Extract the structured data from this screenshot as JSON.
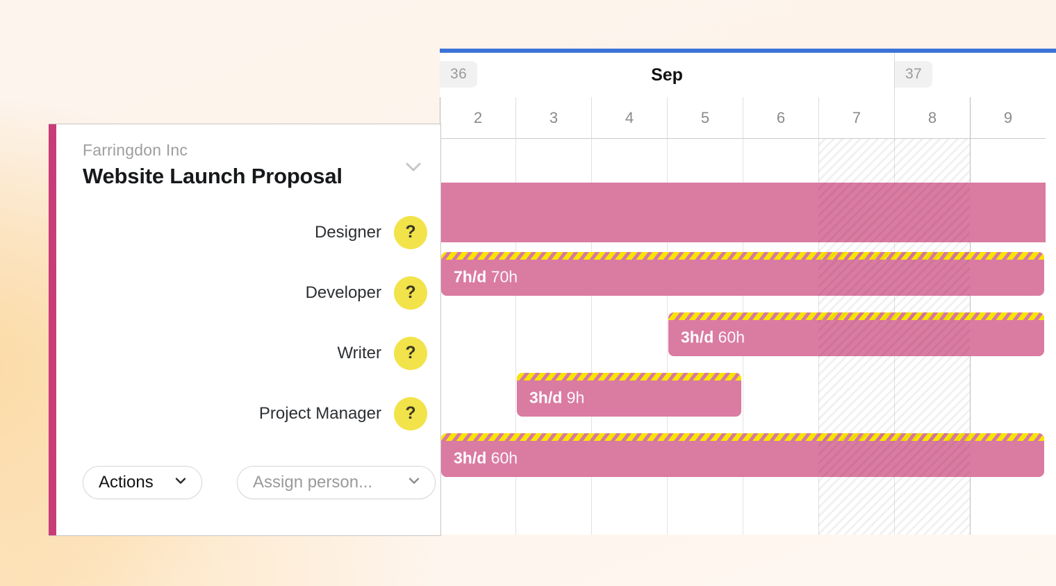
{
  "colors": {
    "accent_pink": "#c83c77",
    "bar_pink": "#da7ba2",
    "stripe_yellow": "#f7e500",
    "avatar_yellow": "#f2e34a",
    "top_rule_blue": "#3b73d6",
    "background_peach": "#fbd9a2"
  },
  "timeline": {
    "month_label": "Sep",
    "weeks": [
      {
        "number": "36",
        "start_day_index": 0,
        "day_span": 6
      },
      {
        "number": "37",
        "start_day_index": 6,
        "day_span": 2
      }
    ],
    "days": [
      {
        "label": "2",
        "weekend": false,
        "first_of_week": true
      },
      {
        "label": "3",
        "weekend": false,
        "first_of_week": false
      },
      {
        "label": "4",
        "weekend": false,
        "first_of_week": false
      },
      {
        "label": "5",
        "weekend": false,
        "first_of_week": false
      },
      {
        "label": "6",
        "weekend": false,
        "first_of_week": false
      },
      {
        "label": "7",
        "weekend": true,
        "first_of_week": false
      },
      {
        "label": "8",
        "weekend": true,
        "first_of_week": false
      },
      {
        "label": "9",
        "weekend": false,
        "first_of_week": true
      }
    ]
  },
  "card": {
    "client": "Farringdon Inc",
    "title": "Website Launch Proposal",
    "collapse_icon": "chevron-down-icon",
    "footer": {
      "actions_label": "Actions",
      "actions_icon": "chevron-down-icon",
      "assign_placeholder": "Assign person...",
      "assign_icon": "chevron-down-icon"
    }
  },
  "rows": [
    {
      "role": "Designer",
      "avatar_glyph": "?",
      "rate": "7h/d",
      "total": "70h",
      "start_day_index": 0,
      "end_day_index": 8
    },
    {
      "role": "Developer",
      "avatar_glyph": "?",
      "rate": "3h/d",
      "total": "60h",
      "start_day_index": 3,
      "end_day_index": 8
    },
    {
      "role": "Writer",
      "avatar_glyph": "?",
      "rate": "3h/d",
      "total": "9h",
      "start_day_index": 1,
      "end_day_index": 4
    },
    {
      "role": "Project Manager",
      "avatar_glyph": "?",
      "rate": "3h/d",
      "total": "60h",
      "start_day_index": 0,
      "end_day_index": 8
    }
  ],
  "summary_bar": {
    "start_day_index": 0,
    "end_day_index": 8
  }
}
